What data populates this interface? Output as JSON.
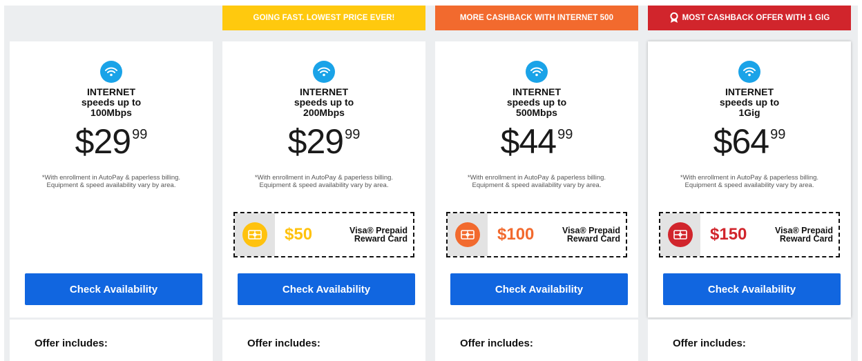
{
  "plans": [
    {
      "banner": "",
      "title_line1": "INTERNET",
      "title_line2": "speeds up to",
      "title_line3": "100Mbps",
      "price_dollars": "$29",
      "price_cents": "99",
      "fine_line1": "*With enrollment in AutoPay & paperless billing.",
      "fine_line2": "Equipment & speed availability vary by area.",
      "cta": "Check Availability",
      "offer_label": "Offer includes:"
    },
    {
      "banner": "GOING FAST. LOWEST PRICE EVER!",
      "title_line1": "INTERNET",
      "title_line2": "speeds up to",
      "title_line3": "200Mbps",
      "price_dollars": "$29",
      "price_cents": "99",
      "fine_line1": "*With enrollment in AutoPay & paperless billing.",
      "fine_line2": "Equipment & speed availability vary by area.",
      "reward_amount": "$50",
      "reward_line1": "Visa® Prepaid",
      "reward_line2": "Reward Card",
      "cta": "Check Availability",
      "offer_label": "Offer includes:"
    },
    {
      "banner": "MORE CASHBACK WITH INTERNET 500",
      "title_line1": "INTERNET",
      "title_line2": "speeds up to",
      "title_line3": "500Mbps",
      "price_dollars": "$44",
      "price_cents": "99",
      "fine_line1": "*With enrollment in AutoPay & paperless billing.",
      "fine_line2": "Equipment & speed availability vary by area.",
      "reward_amount": "$100",
      "reward_line1": "Visa® Prepaid",
      "reward_line2": "Reward Card",
      "cta": "Check Availability",
      "offer_label": "Offer includes:"
    },
    {
      "banner": "MOST CASHBACK OFFER WITH 1 GIG",
      "title_line1": "INTERNET",
      "title_line2": "speeds up to",
      "title_line3": "1Gig",
      "price_dollars": "$64",
      "price_cents": "99",
      "fine_line1": "*With enrollment in AutoPay & paperless billing.",
      "fine_line2": "Equipment & speed availability vary by area.",
      "reward_amount": "$150",
      "reward_line1": "Visa® Prepaid",
      "reward_line2": "Reward Card",
      "cta": "Check Availability",
      "offer_label": "Offer includes:"
    }
  ],
  "colors": {
    "banner_yellow": "#ffc90e",
    "banner_orange": "#f26a2e",
    "banner_red": "#d1252c",
    "reward_yellow": "#ffc20e",
    "reward_orange": "#f26a2e",
    "reward_red": "#d1252c",
    "cta_blue": "#1166e0",
    "wifi_blue": "#1aa3e8"
  },
  "icons": {
    "wifi": "wifi-icon",
    "award": "award-ribbon-icon",
    "gift_card": "gift-card-icon"
  }
}
